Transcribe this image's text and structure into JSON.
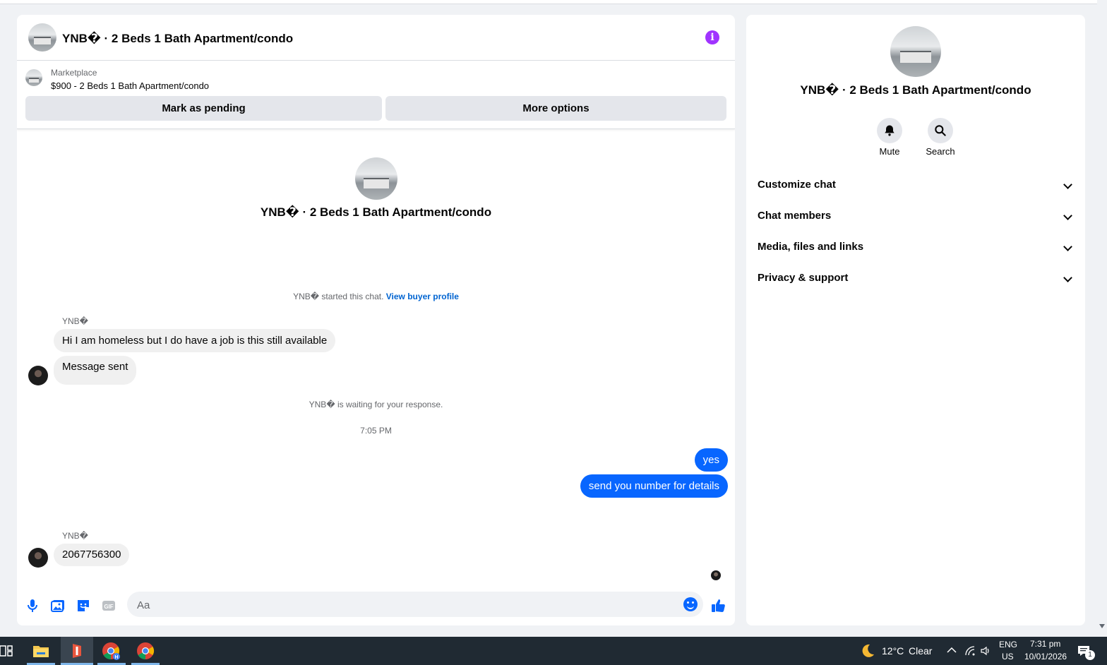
{
  "chat": {
    "title": "YNB� · 2 Beds 1 Bath Apartment/condo",
    "marketplace": {
      "label": "Marketplace",
      "listing": "$900 - 2 Beds 1 Bath Apartment/condo",
      "mark_pending": "Mark as pending",
      "more_options": "More options"
    },
    "intro_title": "YNB� · 2 Beds 1 Bath Apartment/condo",
    "started_text": "YNB� started this chat. ",
    "view_buyer_profile": "View buyer profile",
    "messages": {
      "sender1": "YNB�",
      "msg1": "Hi I am homeless but I do have a job is this still available",
      "msg2": "Message sent",
      "waiting": "YNB� is waiting for your response.",
      "time": "7:05 PM",
      "out1": "yes",
      "out2": "send you number for details",
      "sender2": "YNB�",
      "msg3": "2067756300"
    },
    "composer": {
      "placeholder": "Aa",
      "icons": [
        "microphone-icon",
        "photo-icon",
        "sticker-icon",
        "gif-icon",
        "emoji-icon",
        "thumbs-up-icon"
      ]
    }
  },
  "side": {
    "title": "YNB� · 2 Beds 1 Bath Apartment/condo",
    "mute": "Mute",
    "search": "Search",
    "sections": [
      "Customize chat",
      "Chat members",
      "Media, files and links",
      "Privacy & support"
    ]
  },
  "taskbar": {
    "weather_temp": "12°C",
    "weather_desc": "Clear",
    "lang": "ENG",
    "region": "US",
    "time": "7:31 pm",
    "date": "10/01/2026",
    "notifications": "1"
  },
  "colors": {
    "accent": "#0866ff",
    "info": "#a033ff",
    "taskbar": "#202a33"
  }
}
